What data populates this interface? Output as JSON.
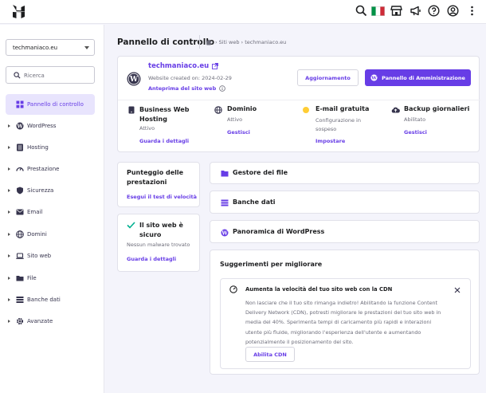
{
  "sidebar": {
    "selected_site": "techmaniaco.eu",
    "search_placeholder": "Ricerca",
    "items": [
      {
        "label": "Pannello di controllo"
      },
      {
        "label": "WordPress"
      },
      {
        "label": "Hosting"
      },
      {
        "label": "Prestazione"
      },
      {
        "label": "Sicurezza"
      },
      {
        "label": "Email"
      },
      {
        "label": "Domini"
      },
      {
        "label": "Sito web"
      },
      {
        "label": "File"
      },
      {
        "label": "Banche dati"
      },
      {
        "label": "Avanzate"
      }
    ]
  },
  "header": {
    "title": "Pannello di controllo",
    "breadcrumb": "› Siti web › techmaniaco.eu"
  },
  "site": {
    "domain": "techmaniaco.eu",
    "created": "Website created on: 2024-02-29",
    "preview": "Anteprima del sito web",
    "update_button": "Aggiornamento",
    "admin_button": "Pannello di Amministrazione"
  },
  "services": [
    {
      "title": "Business Web Hosting",
      "status": "Attivo",
      "action": "Guarda i dettagli"
    },
    {
      "title": "Dominio",
      "status": "Attivo",
      "action": "Gestisci"
    },
    {
      "title": "E-mail gratuita",
      "status": "Configurazione in sospeso",
      "action": "Impostare"
    },
    {
      "title": "Backup giornalieri",
      "status": "Abilitato",
      "action": "Gestisci"
    }
  ],
  "speed": {
    "title": "Punteggio delle prestazioni",
    "action": "Esegui il test di velocità"
  },
  "security": {
    "title": "Il sito web è sicuro",
    "status": "Nessun malware trovato",
    "action": "Guarda i dettagli"
  },
  "quick_links": [
    {
      "label": "Gestore dei file"
    },
    {
      "label": "Banche dati"
    },
    {
      "label": "Panoramica di WordPress"
    }
  ],
  "suggestions": {
    "title": "Suggerimenti per migliorare",
    "item_title": "Aumenta la velocità del tuo sito web con la CDN",
    "item_text": "Non lasciare che il tuo sito rimanga indietro! Abilitando la funzione Content Delivery Network (CDN), potresti migliorare le prestazioni del tuo sito web in media del 40%. Sperimenta tempi di caricamento più rapidi e interazioni utente più fluide, migliorando l'esperienza dell'utente e aumentando potenzialmente il posizionamento del sito.",
    "button": "Abilita CDN"
  },
  "colors": {
    "accent": "#673de6",
    "success": "#00b090",
    "warning": "#ffcd35"
  }
}
